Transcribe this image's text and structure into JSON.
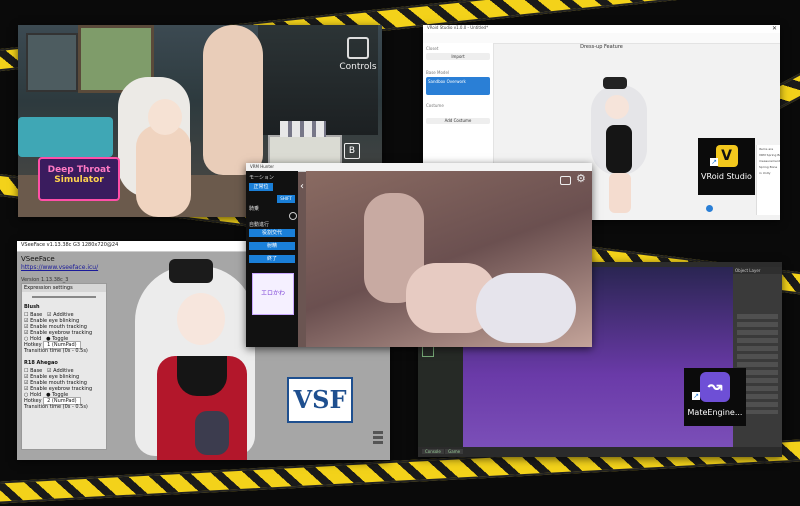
{
  "game": {
    "controls_label": "Controls",
    "key_b": "B",
    "logo_line1": "Deep Throat",
    "logo_line2": "Simulator"
  },
  "vroid": {
    "window_title": "VRoid Studio v1.0.0 - Untitled*",
    "header_title": "Dress-up Feature",
    "sidebar": {
      "section_closet": "Closet",
      "button_import": "Import",
      "section_base_model": "Base Model",
      "selected_item": "Sandbox Overwork",
      "section_costume": "Costume",
      "add_costume_button": "Add Costume"
    },
    "panel_lines": [
      "Items are",
      "VRM Spring Bone",
      "measurements",
      "Spring Bone",
      "in Unity"
    ],
    "badge_label": "VRoid Studio"
  },
  "vseeface": {
    "title": "VSeeFace v1.13.38c G3 1280x720@24",
    "app_name": "VSeeFace",
    "url": "https://www.vseeface.icu/",
    "version_label": "Version 1.13.38c_3",
    "expression_settings": "Expression settings",
    "blush_heading": "Blush",
    "options": {
      "base": "Base",
      "additive": "Additive",
      "enable_eye_blinking": "Enable eye blinking",
      "enable_mouth_tracking": "Enable mouth tracking",
      "enable_eyebrow_tracking": "Enable eyebrow tracking",
      "hold": "Hold",
      "toggle": "Toggle",
      "hotkey": "Hotkey",
      "transition_time": "Transition time (0s - 0.5s)"
    },
    "blush_hotkey_value": "1 (NumPad)",
    "rte_heading": "R18 Ahegao",
    "rte_hotkey_value": "2 (NumPad)",
    "logo_letters": "VSF"
  },
  "mate_engine": {
    "badge_label": "MateEngine...",
    "panel_title": "Object Layer",
    "status_tabs": [
      "Console",
      "Game"
    ]
  },
  "center_app": {
    "window_title": "VRM Hunter",
    "menu_title": "モーション",
    "mode_label": "正常位",
    "sub_label": "騎乗",
    "small_button": "SHIFT",
    "auto_toggle_label": "自動進行",
    "actions": [
      "役割交代",
      "射精",
      "終了"
    ],
    "sticker_text": "エロかわ"
  },
  "colors": {
    "tape_yellow": "#f3d21a",
    "center_button_blue": "#1a7fd8",
    "vroid_accent": "#2a7fd6",
    "mate_purple": "#5a2ea0"
  }
}
